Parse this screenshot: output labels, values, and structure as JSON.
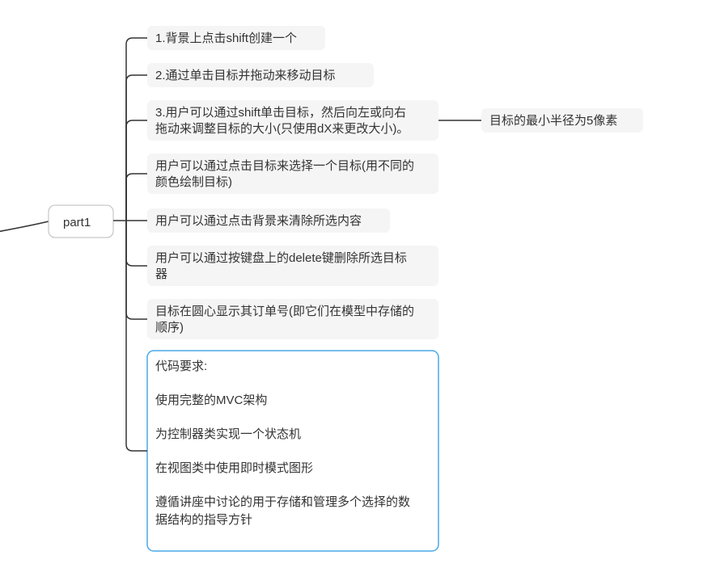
{
  "root": {
    "label": "part1"
  },
  "children": [
    {
      "text": "1.背景上点击shift创建一个"
    },
    {
      "text": "2.通过单击目标并拖动来移动目标"
    },
    {
      "lines": [
        "3.用户可以通过shift单击目标，然后向左或向右",
        "拖动来调整目标的大小(只使用dX来更改大小)。"
      ],
      "child": {
        "text": "目标的最小半径为5像素"
      }
    },
    {
      "lines": [
        "用户可以通过点击目标来选择一个目标(用不同的",
        "颜色绘制目标)"
      ]
    },
    {
      "text": "用户可以通过点击背景来清除所选内容"
    },
    {
      "lines": [
        "用户可以通过按键盘上的delete键删除所选目标",
        "器"
      ]
    },
    {
      "lines": [
        "目标在圆心显示其订单号(即它们在模型中存储的",
        "顺序)"
      ]
    },
    {
      "selected": true,
      "lines": [
        "代码要求:",
        "",
        "使用完整的MVC架构",
        "",
        "为控制器类实现一个状态机",
        "",
        "在视图类中使用即时模式图形",
        "",
        "遵循讲座中讨论的用于存储和管理多个选择的数",
        "据结构的指导方针"
      ]
    }
  ]
}
